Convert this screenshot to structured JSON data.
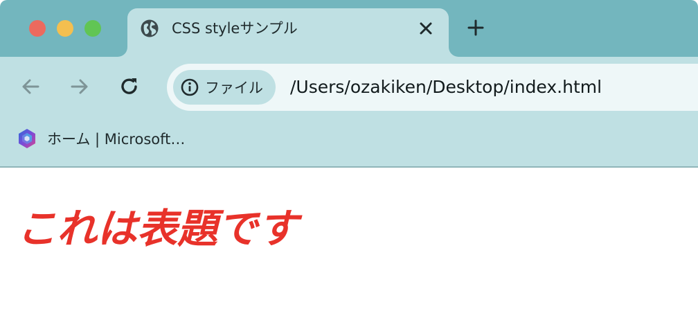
{
  "browser": {
    "tab": {
      "title": "CSS styleサンプル",
      "favicon": "globe-icon"
    },
    "toolbar": {
      "security_chip_label": "ファイル",
      "url": "/Users/ozakiken/Desktop/index.html"
    },
    "bookmarks": [
      {
        "label": "ホーム | Microsoft…",
        "icon": "microsoft365-icon"
      }
    ]
  },
  "page": {
    "heading": "これは表題です",
    "heading_color": "#e8322a"
  },
  "colors": {
    "tabstrip": "#73b6be",
    "toolbar": "#bfe0e3",
    "omnibox": "#eef7f8",
    "traffic_close": "#ec6a5e",
    "traffic_min": "#f4bf4f",
    "traffic_max": "#61c554"
  }
}
